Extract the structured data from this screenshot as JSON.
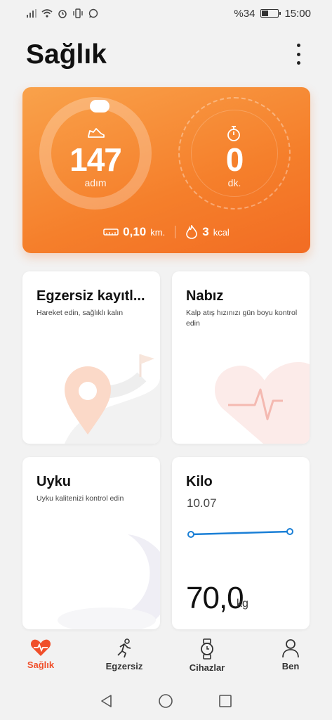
{
  "status_bar": {
    "battery": "%34",
    "time": "15:00",
    "battery_level": 0.34
  },
  "page": {
    "title": "Sağlık"
  },
  "summary": {
    "steps_value": "147",
    "steps_unit": "adım",
    "minutes_value": "0",
    "minutes_unit": "dk.",
    "distance_value": "0,10",
    "distance_unit": "km.",
    "calories_value": "3",
    "calories_unit": "kcal"
  },
  "cards": {
    "exercise": {
      "title": "Egzersiz kayıtl...",
      "subtitle": "Hareket edin, sağlıklı kalın"
    },
    "heart": {
      "title": "Nabız",
      "subtitle": "Kalp atış hızınızı gün boyu kontrol edin"
    },
    "sleep": {
      "title": "Uyku",
      "subtitle": "Uyku kalitenizi kontrol edin"
    },
    "weight": {
      "title": "Kilo",
      "date": "10.07",
      "value": "70,0",
      "unit": "kg"
    }
  },
  "nav": {
    "items": [
      {
        "label": "Sağlık",
        "icon": "heart-pulse-icon",
        "active": true
      },
      {
        "label": "Egzersiz",
        "icon": "running-icon",
        "active": false
      },
      {
        "label": "Cihazlar",
        "icon": "watch-icon",
        "active": false
      },
      {
        "label": "Ben",
        "icon": "person-icon",
        "active": false
      }
    ]
  },
  "colors": {
    "accent": "#f04f2a",
    "hero_start": "#f9a24b",
    "hero_end": "#f26c23",
    "chart_line": "#1a7fd6"
  }
}
